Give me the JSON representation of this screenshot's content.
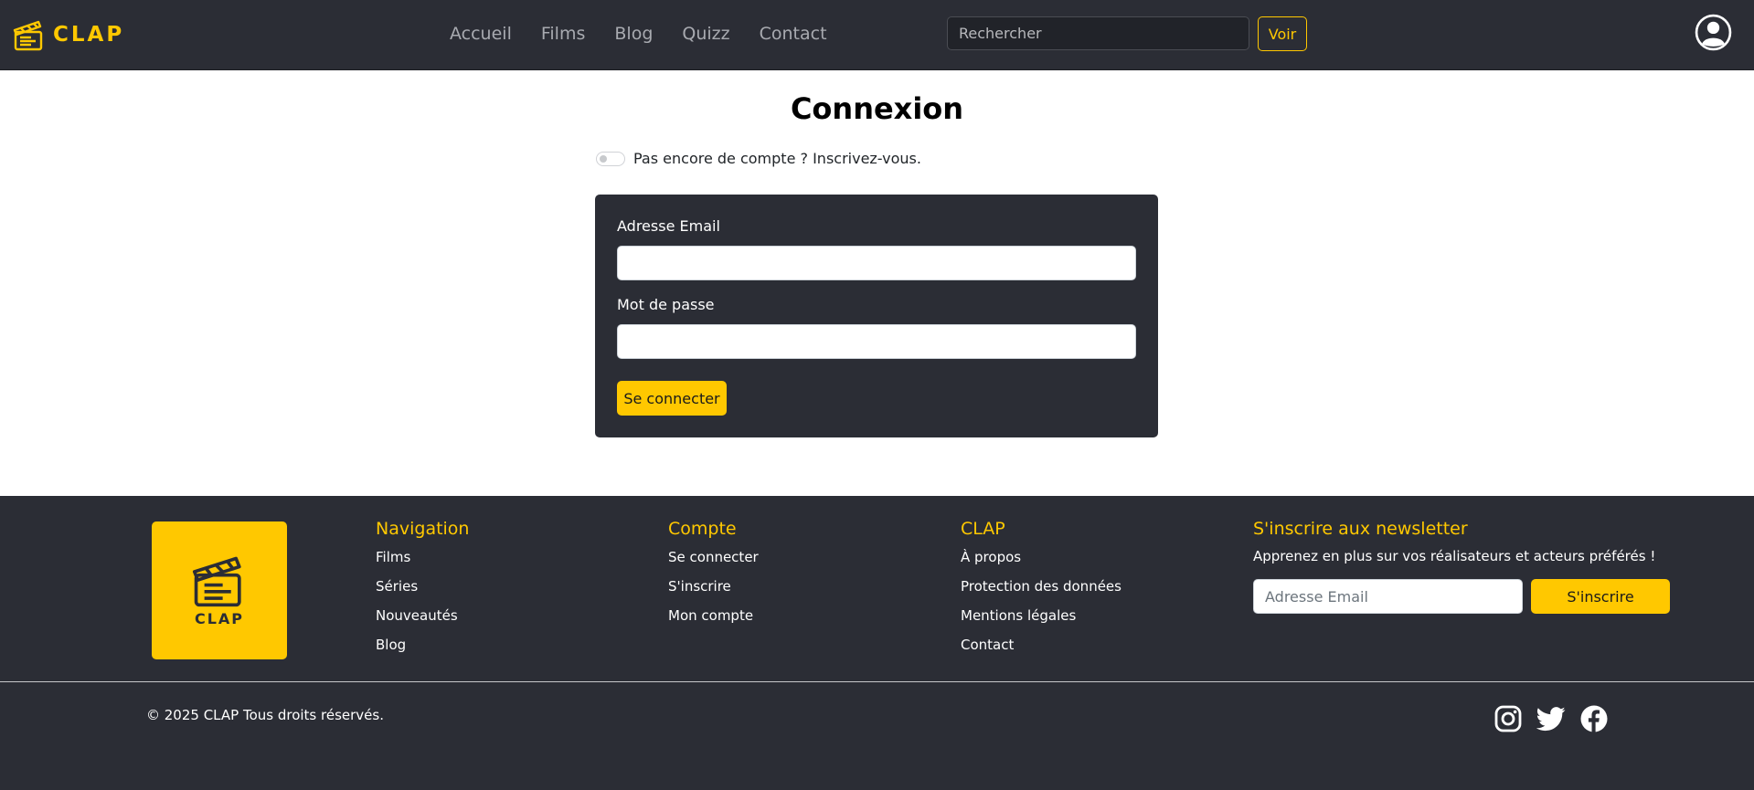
{
  "header": {
    "brand": "CLAP",
    "nav": [
      "Accueil",
      "Films",
      "Blog",
      "Quizz",
      "Contact"
    ],
    "search_placeholder": "Rechercher",
    "search_button": "Voir"
  },
  "main": {
    "title": "Connexion",
    "toggle_label": "Pas encore de compte ? Inscrivez-vous.",
    "email_label": "Adresse Email",
    "password_label": "Mot de passe",
    "submit_label": "Se connecter"
  },
  "footer": {
    "logo_text": "CLAP",
    "columns": [
      {
        "title": "Navigation",
        "links": [
          "Films",
          "Séries",
          "Nouveautés",
          "Blog"
        ]
      },
      {
        "title": "Compte",
        "links": [
          "Se connecter",
          "S'inscrire",
          "Mon compte"
        ]
      },
      {
        "title": "CLAP",
        "links": [
          "À propos",
          "Protection des données",
          "Mentions légales",
          "Contact"
        ]
      }
    ],
    "newsletter": {
      "title": "S'inscrire aux newsletter",
      "description": "Apprenez en plus sur vos réalisateurs et acteurs préférés !",
      "placeholder": "Adresse Email",
      "button": "S'inscrire"
    },
    "copyright": "© 2025 CLAP Tous droits réservés.",
    "socials": [
      "instagram-icon",
      "twitter-icon",
      "facebook-icon"
    ]
  },
  "colors": {
    "accent": "#ffc800",
    "dark": "#2b2d35"
  }
}
